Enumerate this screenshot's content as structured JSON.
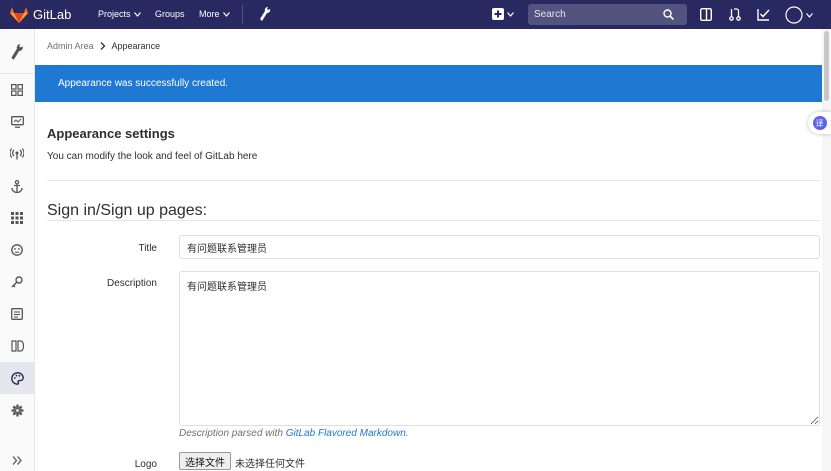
{
  "navbar": {
    "brand": "GitLab",
    "projects": "Projects",
    "groups": "Groups",
    "more": "More",
    "search_placeholder": "Search"
  },
  "breadcrumb": {
    "parent": "Admin Area",
    "current": "Appearance"
  },
  "flash": {
    "message": "Appearance was successfully created."
  },
  "settings": {
    "title": "Appearance settings",
    "description": "You can modify the look and feel of GitLab here"
  },
  "signin_section": {
    "heading": "Sign in/Sign up pages:",
    "title_label": "Title",
    "title_value": "有问题联系管理员",
    "description_label": "Description",
    "description_value": "有问题联系管理员",
    "hint_prefix": "Description parsed with",
    "hint_link": "GitLab Flavored Markdown",
    "hint_suffix": ".",
    "logo_label": "Logo",
    "file_button": "选择文件",
    "file_status": "未选择任何文件"
  },
  "float_badge": {
    "glyph": "译"
  },
  "colors": {
    "navbar": "#292961",
    "flash": "#1f78d1",
    "link": "#1f78d1"
  }
}
